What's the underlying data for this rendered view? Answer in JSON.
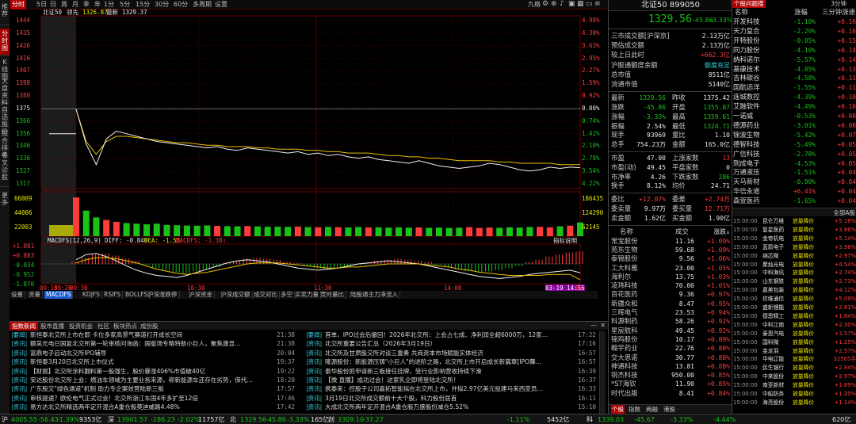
{
  "left_toolbar": [
    "推荐",
    "分时图",
    "K线图",
    "大盘资料",
    "自选报价",
    "综合排名",
    "牛叉诊股",
    "更多"
  ],
  "top_tabs": [
    "分时",
    "5日",
    "日",
    "周",
    "月",
    "季",
    "年",
    "1分",
    "5分",
    "15分",
    "30分",
    "60分",
    "多周期",
    "设置"
  ],
  "top_right": {
    "nine_grid": "九格",
    "icons": [
      "gear-icon",
      "add-icon",
      "bell-icon",
      "lock-icon",
      "grid-icon",
      "window-icon",
      "menu-icon",
      "link-icon",
      "download-icon"
    ]
  },
  "chart_header": {
    "name": "北证50",
    "label": "领先",
    "value1": "1326.87",
    "label2": "最新",
    "value2": "1329.37"
  },
  "chart_data": {
    "type": "line",
    "title": "",
    "price_axis_left": [
      "1444",
      "1435",
      "1426",
      "1416",
      "1407",
      "1398",
      "1388",
      "1375",
      "1366",
      "1356",
      "1346",
      "1336",
      "1327",
      "1317"
    ],
    "price_axis_right": [
      "4.98%",
      "4.30%",
      "3.63%",
      "2.95%",
      "2.27%",
      "1.59%",
      "0.92%",
      "0.00%",
      "0.74%",
      "1.42%",
      "2.10%",
      "2.78%",
      "3.54%",
      "4.22%"
    ],
    "volume_axis_left": [
      "66009",
      "44006",
      "22003"
    ],
    "volume_axis_right": [
      "186435",
      "124290",
      "62145"
    ],
    "macd_axis_left": [
      "+1.801",
      "+0.883",
      "-0.034",
      "-0.952",
      "-1.870"
    ],
    "time_axis": [
      "09:15",
      "09:20",
      "09:30",
      "10:30",
      "11:30",
      "14:00",
      "03-19 14:56",
      "00"
    ],
    "pre_close": 1375.42,
    "open": 1355.07,
    "high": 1359.61,
    "low": 1324.71,
    "last": 1329.56,
    "price_series": [
      1375,
      1348,
      1332,
      1352,
      1358,
      1356,
      1354,
      1352,
      1350,
      1349,
      1348,
      1347,
      1346,
      1345,
      1346,
      1344,
      1343,
      1345,
      1344,
      1343,
      1342,
      1341,
      1342,
      1340,
      1341,
      1339,
      1340,
      1338,
      1337,
      1338,
      1336,
      1335,
      1334,
      1333,
      1335,
      1333,
      1331,
      1330,
      1329,
      1330,
      1331,
      1333,
      1332,
      1330,
      1328,
      1327,
      1328,
      1330,
      1329,
      1330,
      1329.56
    ],
    "avg_series": [
      1375,
      1350,
      1340,
      1350,
      1354,
      1354,
      1353,
      1352,
      1351,
      1350,
      1349,
      1349,
      1348,
      1347,
      1347,
      1346,
      1346,
      1346,
      1345,
      1345,
      1344,
      1344,
      1344,
      1343,
      1343,
      1342,
      1342,
      1341,
      1341,
      1341,
      1340,
      1339,
      1339,
      1338,
      1338,
      1337,
      1337,
      1336,
      1335,
      1335,
      1335,
      1335,
      1334,
      1334,
      1333,
      1333,
      1333,
      1333,
      1332,
      1332,
      1332
    ],
    "volume_series": [
      62000,
      41000,
      30000,
      26000,
      23000,
      21000,
      20000,
      19000,
      20000,
      18000,
      17500,
      17000,
      16800,
      17200,
      16500,
      16000,
      15800,
      16200,
      15600,
      15000,
      15200,
      14800,
      15400,
      14600,
      14200,
      14800,
      14400,
      14100,
      14600,
      14000,
      14300,
      13800,
      14200,
      13600,
      14000,
      13400,
      13800,
      13200,
      13600,
      14400,
      13200,
      13900,
      13500,
      14200,
      13800,
      14600,
      15000,
      14200,
      15800,
      16800,
      22000
    ],
    "macd_hist": [
      0.2,
      0.6,
      0.9,
      1.0,
      0.8,
      0.5,
      0.3,
      -0.1,
      -0.4,
      -0.6,
      -0.8,
      -0.9,
      -0.7,
      -0.5,
      -0.3,
      0.1,
      0.3,
      0.5,
      0.6,
      0.5,
      0.4,
      0.2,
      0.1,
      -0.2,
      -0.4,
      -0.5,
      -0.4,
      -0.3,
      -0.1,
      0.1,
      0.3,
      0.4,
      0.5,
      0.4,
      0.3,
      0.2,
      -0.1,
      -0.3,
      -0.5,
      -0.7,
      -0.8,
      -0.7,
      -0.6,
      -0.4,
      -0.2,
      0.2,
      0.4,
      0.7,
      0.9,
      1.1,
      1.2
    ],
    "macd_dif": [
      0.4,
      0.9,
      1.0,
      0.7,
      0.3,
      -0.2,
      -0.6,
      -0.9,
      -1.1,
      -1.2,
      -1.3,
      -1.1,
      -0.8,
      -0.5,
      -0.2,
      0.1,
      0.3,
      0.4,
      0.3,
      0.2,
      0.0,
      -0.2,
      -0.4,
      -0.5,
      -0.6,
      -0.5,
      -0.4,
      -0.2,
      0.0,
      0.1,
      0.2,
      0.3,
      0.2,
      0.1,
      0.0,
      -0.2,
      -0.4,
      -0.6,
      -0.8,
      -1.0,
      -1.2,
      -1.3,
      -1.4,
      -1.3,
      -1.2,
      -1.0,
      -0.9,
      -0.8,
      -0.7,
      -0.6,
      -0.84
    ],
    "macd_dea": [
      0.1,
      0.4,
      0.6,
      0.6,
      0.5,
      0.3,
      0.1,
      -0.2,
      -0.5,
      -0.7,
      -0.9,
      -1.0,
      -0.9,
      -0.8,
      -0.6,
      -0.4,
      -0.2,
      0.0,
      0.1,
      0.1,
      0.1,
      0.0,
      -0.1,
      -0.2,
      -0.3,
      -0.4,
      -0.4,
      -0.3,
      -0.3,
      -0.2,
      -0.1,
      0.0,
      0.0,
      0.0,
      0.0,
      -0.1,
      -0.2,
      -0.3,
      -0.5,
      -0.6,
      -0.8,
      -0.9,
      -1.0,
      -1.1,
      -1.1,
      -1.1,
      -1.1,
      -1.0,
      -1.0,
      -1.0,
      -1.53
    ],
    "ylim": [
      1317,
      1444
    ],
    "grid": true
  },
  "macd_label": {
    "title": "MACDFS(12,26,9)",
    "dif": "DIFF: -0.840",
    "dea": "DEA: -1.53",
    "macd": "MACDFS: -1.38↑",
    "link": "指标说明"
  },
  "indicator_tabs": [
    "设置",
    "资量",
    "MACDFS",
    "KDJFS",
    "RSIFS",
    "BOLLFS",
    "沪深涨跌停",
    "沪深资金",
    "沪深成交额",
    "成交对比",
    "多空",
    "买卖力量",
    "竞时量比",
    "陆股通主力净流入"
  ],
  "news_tabs": [
    "指数新闻",
    "股市直播",
    "投资机会",
    "社区",
    "板块热点",
    "成份股"
  ],
  "news_left": [
    {
      "cat": "要闻",
      "title": "新恒泰北交所上市在即 卡位多家高景气赛道打开成长空间",
      "time": "21:38"
    },
    {
      "cat": "资讯",
      "title": "额吴光电已国复北交所第一轮审核问询函：国版场专精特新小巨人，聚焦康显…",
      "time": "21:38"
    },
    {
      "cat": "资讯",
      "title": "富鼎电子启动北交所IPO辅导",
      "time": "20:04"
    },
    {
      "cat": "资讯",
      "title": "新恒泰3月20日北交所上市仪式",
      "time": "19:37"
    },
    {
      "cat": "资讯",
      "title": "【财报】北交所涂料翻料第一股强生，股价暴涨406%市值破40亿",
      "time": "19:22"
    },
    {
      "cat": "资讯",
      "title": "安达股份北交所上会：燃油车领域为主要业务来源，称新能源车还存在劣势，保代…",
      "time": "18:20"
    },
    {
      "cat": "资讯",
      "title": "广东股交\"绿色通道\"机制 助力专企案效营陆新三板",
      "time": "17:57"
    },
    {
      "cat": "资讯",
      "title": "审核提速？欧伦电气正式过会！北交所浙江车国4年多扩至12倍",
      "time": "17:46"
    },
    {
      "cat": "资讯",
      "title": "易方达北交所精选两年定开混合A重仓股莫迪威路4.48%",
      "time": "17:42"
    }
  ],
  "news_right": [
    {
      "cat": "要闻",
      "title": "首单，IPO过会后撤回！2026年北交所：上会占七成、净利润全超6000万，12家…",
      "time": "17:22"
    },
    {
      "cat": "资讯",
      "title": "北交所重要公告汇总（2026年3月19日）",
      "time": "17:16"
    },
    {
      "cat": "资讯",
      "title": "北交所及甘肃股交所对谈三重奏 共商资本市场赋能实体经济",
      "time": "16:57"
    },
    {
      "cat": "资讯",
      "title": "隆源股份：新能源压铸\"小巨人\"的进阶之路，北交所上市开启成长新篇章[IPO舞…",
      "time": "16:57"
    },
    {
      "cat": "资讯",
      "title": "泰华股份抓申请新三板接任挂牌，受行业影响营收持续下滑",
      "time": "16:39"
    },
    {
      "cat": "资讯",
      "title": "【微 直播】成功过会！这家乳企即将登陆北交所！",
      "time": "16:37"
    },
    {
      "cat": "资讯",
      "title": "携泰来：控股子公司嘉拓智能拟在北交所上市，并拟2.97亿美元投建马来西亚员…",
      "time": "16:33"
    },
    {
      "cat": "资讯",
      "title": "3月19日北交所成交额前十大个股，科力股份居首",
      "time": "16:11"
    },
    {
      "cat": "资讯",
      "title": "大成北交所两年定开混合A重仓股万盛股份减仓5.52%",
      "time": "15:10"
    }
  ],
  "quote": {
    "header_label": "北证50",
    "code": "899050",
    "price": "1329.56",
    "change": "-45.86",
    "pct": "-3.33%",
    "rows1": [
      {
        "label": "三市成交额[沪深京]",
        "value": "2.13万亿",
        "color": "white"
      },
      {
        "label": "预估成交额",
        "value": "2.13万亿",
        "color": "white"
      },
      {
        "label": "较上日此时",
        "value": "+662.3亿",
        "color": "red"
      },
      {
        "label": "沪股通额度余额",
        "value": "额度充足",
        "color": "cyan"
      },
      {
        "label": "总市值",
        "value": "8511亿",
        "color": "white"
      },
      {
        "label": "流通市值",
        "value": "5140亿",
        "color": "white"
      }
    ],
    "rows2": [
      {
        "l1": "最新",
        "v1": "1329.56",
        "c1": "green",
        "l2": "昨收",
        "v2": "1375.42",
        "c2": "white"
      },
      {
        "l1": "涨跌",
        "v1": "-45.86",
        "c1": "green",
        "l2": "开盘",
        "v2": "1355.07",
        "c2": "green"
      },
      {
        "l1": "涨幅",
        "v1": "-3.33%",
        "c1": "green",
        "l2": "最高",
        "v2": "1359.61",
        "c2": "green"
      },
      {
        "l1": "振幅",
        "v1": "2.54%",
        "c1": "white",
        "l2": "最低",
        "v2": "1324.71",
        "c2": "green"
      },
      {
        "l1": "现手",
        "v1": "93969",
        "c1": "white",
        "l2": "量比",
        "v2": "1.10",
        "c2": "white"
      },
      {
        "l1": "总手",
        "v1": "754.23万",
        "c1": "white",
        "l2": "金额",
        "v2": "165.0亿",
        "c2": "white"
      }
    ],
    "rows3": [
      {
        "l1": "市盈",
        "v1": "47.00",
        "l2": "上涨家数",
        "v2": "13",
        "c2": "red"
      },
      {
        "l1": "市盈(动)",
        "v1": "49.45",
        "l2": "平盘家数",
        "v2": "0",
        "c2": "white"
      },
      {
        "l1": "市净率",
        "v1": "4.26",
        "l2": "下跌家数",
        "v2": "286",
        "c2": "green"
      },
      {
        "l1": "换手",
        "v1": "8.12%",
        "l2": "均价",
        "v2": "24.71",
        "c2": "white"
      }
    ],
    "rows4": [
      {
        "l1": "委比",
        "v1": "+12.07%",
        "c1": "red",
        "l2": "委差",
        "v2": "+2.74万",
        "c2": "red"
      },
      {
        "l1": "委卖量",
        "v1": "9.97万",
        "c1": "white",
        "l2": "委买量",
        "v2": "12.71万",
        "c2": "red"
      },
      {
        "l1": "卖金额",
        "v1": "1.62亿",
        "c1": "white",
        "l2": "买金额",
        "v2": "1.90亿",
        "c2": "white"
      }
    ],
    "stock_header": {
      "name": "名称",
      "price": "成交",
      "pct": "涨跌↓"
    },
    "stocks": [
      {
        "name": "常宝股份",
        "price": "11.16",
        "pct": "+1.09%",
        "c": "red"
      },
      {
        "name": "苑东生物",
        "price": "59.68",
        "pct": "+1.09%",
        "c": "red"
      },
      {
        "name": "泰锦股份",
        "price": "9.56",
        "pct": "+1.06%",
        "c": "red"
      },
      {
        "name": "工大科雅",
        "price": "23.00",
        "pct": "+1.05%",
        "c": "red"
      },
      {
        "name": "海利尔",
        "price": "13.75",
        "pct": "+1.03%",
        "c": "red"
      },
      {
        "name": "凌玮科技",
        "price": "70.00",
        "pct": "+1.01%",
        "c": "red"
      },
      {
        "name": "百花医药",
        "price": "9.36",
        "pct": "+0.97%",
        "c": "red"
      },
      {
        "name": "新疆众和",
        "price": "8.47",
        "pct": "+0.95%",
        "c": "red"
      },
      {
        "name": "三晖电气",
        "price": "23.53",
        "pct": "+0.94%",
        "c": "red"
      },
      {
        "name": "科源制药",
        "price": "58.26",
        "pct": "+0.92%",
        "c": "red"
      },
      {
        "name": "星宸航科",
        "price": "49.45",
        "pct": "+0.92%",
        "c": "red"
      },
      {
        "name": "锦鸡股份",
        "price": "10.17",
        "pct": "+0.89%",
        "c": "red"
      },
      {
        "name": "翰宇药业",
        "price": "22.76",
        "pct": "+0.88%",
        "c": "red"
      },
      {
        "name": "交大思诺",
        "price": "30.77",
        "pct": "+0.88%",
        "c": "red"
      },
      {
        "name": "神通科技",
        "price": "13.81",
        "pct": "+0.88%",
        "c": "red"
      },
      {
        "name": "锐杰科技",
        "price": "950.00",
        "pct": "+0.85%",
        "c": "red"
      },
      {
        "name": "*ST海钦",
        "price": "11.90",
        "pct": "+0.85%",
        "c": "red"
      },
      {
        "name": "时代出版",
        "price": "8.41",
        "pct": "+0.84%",
        "c": "red"
      }
    ],
    "bottom_tabs": [
      "个股",
      "指数",
      "两融",
      "港股"
    ],
    "bottom_vals": [
      "1339.03",
      "-3.33%"
    ]
  },
  "sectors": {
    "header": [
      "名称",
      "涨幅",
      "三分钟涨速"
    ],
    "extra_tab": "个股问题搜",
    "period": "3分钟",
    "rows": [
      {
        "name": "开发科技",
        "pct": "-1.10%",
        "spd": "+0.16"
      },
      {
        "name": "天力复合",
        "pct": "-2.29%",
        "spd": "+0.16"
      },
      {
        "name": "开特股份",
        "pct": "-0.05%",
        "spd": "+0.15"
      },
      {
        "name": "同力股份",
        "pct": "-4.10%",
        "spd": "+0.14"
      },
      {
        "name": "纳科诺尔",
        "pct": "-5.57%",
        "spd": "+0.14"
      },
      {
        "name": "基康技术",
        "pct": "-4.05%",
        "spd": "+0.13"
      },
      {
        "name": "吉林碳谷",
        "pct": "-4.58%",
        "spd": "+0.11"
      },
      {
        "name": "国航远洋",
        "pct": "-1.55%",
        "spd": "+0.11"
      },
      {
        "name": "连城数控",
        "pct": "-4.39%",
        "spd": "+0.10"
      },
      {
        "name": "艾融软件",
        "pct": "-4.49%",
        "spd": "+0.10"
      },
      {
        "name": "一诺威",
        "pct": "-0.53%",
        "spd": "+0.08"
      },
      {
        "name": "德源药业",
        "pct": "-3.01%",
        "spd": "+0.08"
      },
      {
        "name": "锦波生物",
        "pct": "-5.42%",
        "spd": "+0.07"
      },
      {
        "name": "德智科技",
        "pct": "-5.49%",
        "spd": "+0.05"
      },
      {
        "name": "广信科技",
        "pct": "-2.78%",
        "spd": "+0.05"
      },
      {
        "name": "则成电子",
        "pct": "-4.53%",
        "spd": "+0.05"
      },
      {
        "name": "万通液压",
        "pct": "-1.51%",
        "spd": "+0.04"
      },
      {
        "name": "天马新材",
        "pct": "-0.90%",
        "spd": "+0.04"
      },
      {
        "name": "华信永道",
        "pct": "+6.41%",
        "spd": "+0.04"
      },
      {
        "name": "森萱医药",
        "pct": "-1.65%",
        "spd": "+0.04"
      }
    ],
    "bottom_header": {
      "left": "",
      "right": "全部A股"
    },
    "tape_times": [
      "15:00:00",
      "15:00:00",
      "15:00:00",
      "15:00:00",
      "15:00:00",
      "15:00:00",
      "15:00:00",
      "15:00:00",
      "15:00:00",
      "15:00:00",
      "15:00:00",
      "15:00:00",
      "15:00:00",
      "15:00:00",
      "15:00:00",
      "15:00:00",
      "15:00:00",
      "15:00:00",
      "15:00:00",
      "15:00:00",
      "15:00:00",
      "15:00:00"
    ],
    "tape_names": [
      "昆仑万维",
      "复星医药",
      "金帝机电",
      "蓝箭电子",
      "纳芯微",
      "聚灿光电",
      "中科海讯",
      "山东钢铁",
      "嘉美包装",
      "信维通信",
      "盛新锂能",
      "德恩精工",
      "中科江南",
      "豪恩汽电",
      "国科微",
      "金龙羽",
      "华电辽能",
      "民生银行",
      "中来股份",
      "南亚新材",
      "中船防务",
      "海亮股份"
    ],
    "tape_types": [
      "放量降价",
      "放量降价",
      "放量降价",
      "放量降价",
      "放量降价",
      "放量降价",
      "放量降价",
      "放量降价",
      "放量降价",
      "放量降价",
      "放量降价",
      "放量降价",
      "放量降价",
      "放量降价",
      "放量降价",
      "放量降价",
      "放量降价",
      "放量降价",
      "放量降价",
      "放量降价",
      "放量降价",
      "放量降价"
    ],
    "tape_vals": [
      "+5.16%",
      "+3.86%",
      "+5.14%",
      "+3.56%",
      "+2.97%",
      "+4.54%",
      "+2.74%",
      "+2.73%",
      "+4.12%",
      "+5.09%",
      "+2.81%",
      "+1.84%",
      "+2.30%",
      "+3.57%",
      "+1.25%",
      "+2.57%",
      "32505手",
      "+2.84%",
      "+2.97%",
      "+1.89%",
      "+1.20%",
      "+1.14%"
    ]
  },
  "status": {
    "items": [
      {
        "t": "沪",
        "c": "white"
      },
      {
        "t": "4005.55",
        "c": "green"
      },
      {
        "t": "-56.43",
        "c": "green"
      },
      {
        "t": "-1.39%",
        "c": "green"
      },
      {
        "t": "9353亿",
        "c": "white"
      },
      {
        "t": "深",
        "c": "white"
      },
      {
        "t": "13901.57",
        "c": "green"
      },
      {
        "t": "-286.23",
        "c": "green"
      },
      {
        "t": "-2.02%",
        "c": "green"
      },
      {
        "t": "11757亿",
        "c": "white"
      },
      {
        "t": "北",
        "c": "white"
      },
      {
        "t": "1329.56",
        "c": "green"
      },
      {
        "t": "-45.86",
        "c": "green"
      },
      {
        "t": "-3.33%",
        "c": "green"
      },
      {
        "t": "165亿",
        "c": "white"
      },
      {
        "t": "创",
        "c": "white"
      },
      {
        "t": "3309.10",
        "c": "green"
      },
      {
        "t": "-37.27",
        "c": "green"
      }
    ],
    "right": [
      {
        "t": "-1.11%",
        "c": "green"
      },
      {
        "t": "5452亿",
        "c": "white"
      },
      {
        "t": "科",
        "c": "white"
      },
      {
        "t": "1339.03",
        "c": "green"
      },
      {
        "t": "-45.67",
        "c": "green"
      },
      {
        "t": "-3.33%",
        "c": "green"
      },
      {
        "t": "-4.44%",
        "c": "green"
      },
      {
        "t": "620亿",
        "c": "white"
      }
    ]
  }
}
